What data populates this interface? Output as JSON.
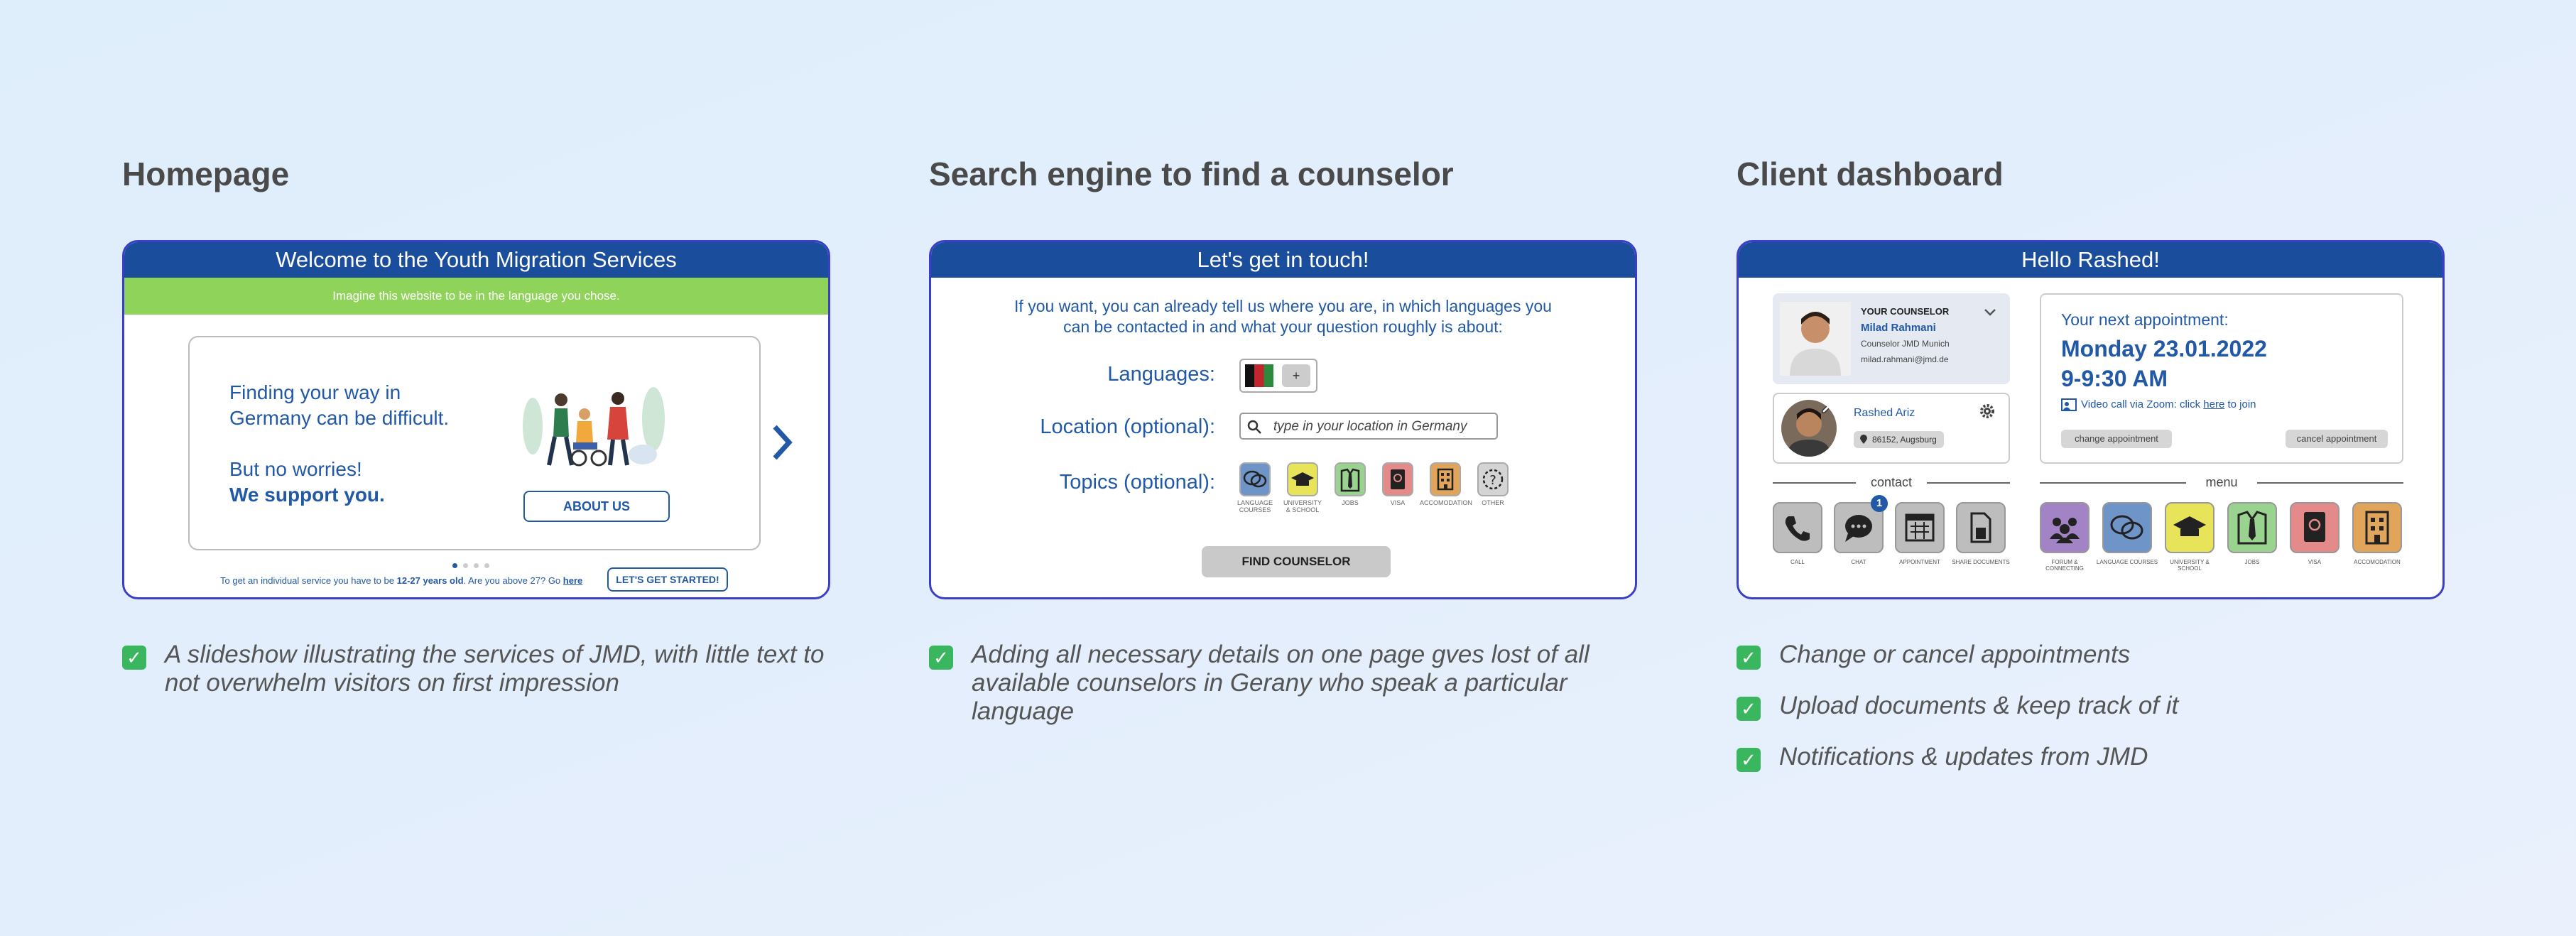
{
  "columns": [
    {
      "title": "Homepage",
      "screen": {
        "header": "Welcome to the Youth Migration Services",
        "subheader": "Imagine this website to be in the language you chose.",
        "slide_line1": "Finding your way in",
        "slide_line2": "Germany can be difficult.",
        "slide_line3": "But no worries!",
        "slide_line4": "We support you.",
        "about_button": "ABOUT US",
        "footer_prefix": "To get an individual service you have to be ",
        "footer_age": "12-27 years old",
        "footer_middle": ". Are you above 27? Go ",
        "footer_link": "here",
        "start_button": "LET'S GET STARTED!"
      },
      "notes": [
        "A slideshow illustrating the services of JMD, with little text to not overwhelm visitors on first impression"
      ]
    },
    {
      "title": "Search engine to find a counselor",
      "screen": {
        "header": "Let's get in touch!",
        "intro_line1": "If you want, you can already tell us where you are, in which languages you",
        "intro_line2": "can be contacted in and what your question roughly is about:",
        "languages_label": "Languages:",
        "add_language": "+",
        "location_label": "Location (optional):",
        "location_placeholder": "type in your location in Germany",
        "topics_label": "Topics (optional):",
        "topics": [
          {
            "label": "LANGUAGE COURSES",
            "icon": "speech-bubbles-icon",
            "color": "#6f94c8"
          },
          {
            "label": "UNIVERSITY & SCHOOL",
            "icon": "graduation-cap-icon",
            "color": "#e7e45a"
          },
          {
            "label": "JOBS",
            "icon": "shirt-tie-icon",
            "color": "#9ad38f"
          },
          {
            "label": "VISA",
            "icon": "passport-icon",
            "color": "#e48a8a"
          },
          {
            "label": "ACCOMODATION",
            "icon": "building-icon",
            "color": "#e0a55a"
          },
          {
            "label": "OTHER",
            "icon": "question-icon",
            "color": "#d4d4d4"
          }
        ],
        "find_button": "FIND COUNSELOR"
      },
      "notes": [
        "Adding all necessary details on one page gves  lost of all available counselors in Gerany who speak a particular language"
      ]
    },
    {
      "title": "Client dashboard",
      "screen": {
        "header": "Hello Rashed!",
        "counselor_heading": "YOUR COUNSELOR",
        "counselor_name": "Milad Rahmani",
        "counselor_role": "Counselor JMD Munich",
        "counselor_email": "milad.rahmani@jmd.de",
        "client_name": "Rashed Ariz",
        "client_location": "86152, Augsburg",
        "next_label": "Your next appointment:",
        "next_date": "Monday 23.01.2022",
        "next_time": "9-9:30 AM",
        "video_prefix": "Video call via Zoom: click ",
        "video_link": "here",
        "video_suffix": " to join",
        "change_button": "change appointment",
        "cancel_button": "cancel appointment",
        "contact_label": "contact",
        "menu_label": "menu",
        "chat_badge": "1",
        "contact_items": [
          {
            "label": "CALL",
            "icon": "phone-icon"
          },
          {
            "label": "CHAT",
            "icon": "chat-icon"
          },
          {
            "label": "APPOINTMENT",
            "icon": "calendar-icon"
          },
          {
            "label": "SHARE DOCUMENTS",
            "icon": "document-icon"
          }
        ],
        "menu_items": [
          {
            "label": "FORUM & CONNECTING",
            "icon": "people-icon",
            "color": "#a283c6"
          },
          {
            "label": "LANGUAGE COURSES",
            "icon": "speech-bubbles-icon",
            "color": "#6f94c8"
          },
          {
            "label": "UNIVERSITY & SCHOOL",
            "icon": "graduation-cap-icon",
            "color": "#e7e45a"
          },
          {
            "label": "JOBS",
            "icon": "shirt-tie-icon",
            "color": "#9ad38f"
          },
          {
            "label": "VISA",
            "icon": "passport-icon",
            "color": "#e48a8a"
          },
          {
            "label": "ACCOMODATION",
            "icon": "building-icon",
            "color": "#e0a55a"
          }
        ]
      },
      "notes": [
        "Change or cancel appointments",
        "Upload documents & keep track of it",
        "Notifications & updates from JMD"
      ]
    }
  ],
  "colors": {
    "brand_blue": "#1a4e9d",
    "accent_green": "#90d35a",
    "frame_border": "#3b3fc8",
    "check_green": "#3ab75e"
  }
}
